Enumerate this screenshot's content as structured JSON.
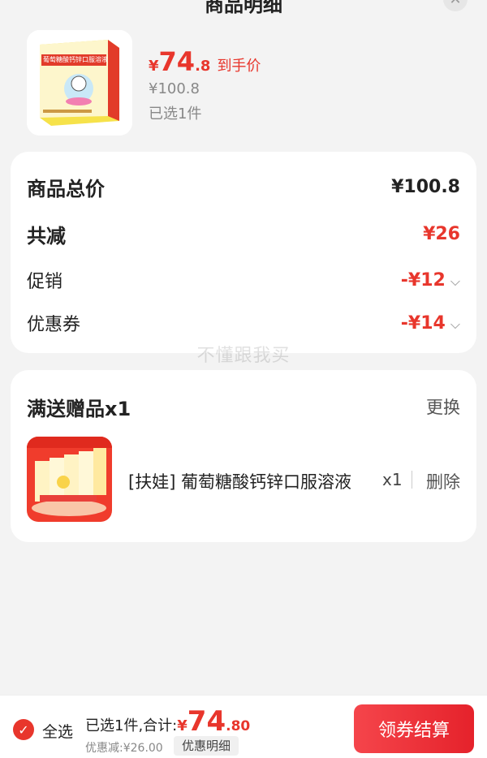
{
  "header": {
    "title": "商品明细",
    "close_icon": "close-icon"
  },
  "product": {
    "price_currency": "¥",
    "price_int": "74",
    "price_dec": ".8",
    "price_tag": "到手价",
    "original_price": "¥100.8",
    "selected": "已选1件",
    "box_text": "葡萄糖酸钙锌口服溶液"
  },
  "summary": {
    "total_label": "商品总价",
    "total_value": "¥100.8",
    "reduce_label": "共减",
    "reduce_value": "¥26",
    "promo_label": "促销",
    "promo_value": "-¥12",
    "coupon_label": "优惠券",
    "coupon_value": "-¥14"
  },
  "watermark": "不懂跟我买",
  "gift": {
    "title": "满送赠品x1",
    "change": "更换",
    "name": "[扶娃] 葡萄糖酸钙锌口服溶液",
    "qty": "x1",
    "delete": "删除"
  },
  "bottom": {
    "select_all": "全选",
    "total_prefix": "已选1件,合计:",
    "total_currency": "¥",
    "total_int": "74",
    "total_dec": ".80",
    "discount": "优惠减:¥26.00",
    "detail": "优惠明细",
    "checkout": "领券结算"
  },
  "colors": {
    "accent": "#e8362c",
    "background": "#f3f3f3"
  }
}
